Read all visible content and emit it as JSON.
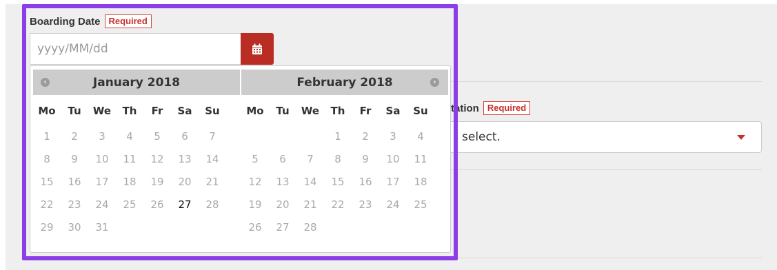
{
  "boarding": {
    "label": "Boarding Date",
    "required": "Required",
    "placeholder": "yyyy/MM/dd"
  },
  "station": {
    "label": "Station",
    "required": "Required",
    "value": "select."
  },
  "calendar": {
    "weekdays": [
      "Mo",
      "Tu",
      "We",
      "Th",
      "Fr",
      "Sa",
      "Su"
    ],
    "months": [
      {
        "title": "January 2018",
        "days": [
          "1",
          "2",
          "3",
          "4",
          "5",
          "6",
          "7",
          "8",
          "9",
          "10",
          "11",
          "12",
          "13",
          "14",
          "15",
          "16",
          "17",
          "18",
          "19",
          "20",
          "21",
          "22",
          "23",
          "24",
          "25",
          "26",
          "27",
          "28",
          "29",
          "30",
          "31"
        ],
        "offset": 0,
        "today": "27"
      },
      {
        "title": "February 2018",
        "days": [
          "1",
          "2",
          "3",
          "4",
          "5",
          "6",
          "7",
          "8",
          "9",
          "10",
          "11",
          "12",
          "13",
          "14",
          "15",
          "16",
          "17",
          "18",
          "19",
          "20",
          "21",
          "22",
          "23",
          "24",
          "25",
          "26",
          "27",
          "28"
        ],
        "offset": 3,
        "today": ""
      }
    ]
  },
  "colors": {
    "accent": "#b92d25",
    "focus_ring": "#8b3ee8"
  }
}
